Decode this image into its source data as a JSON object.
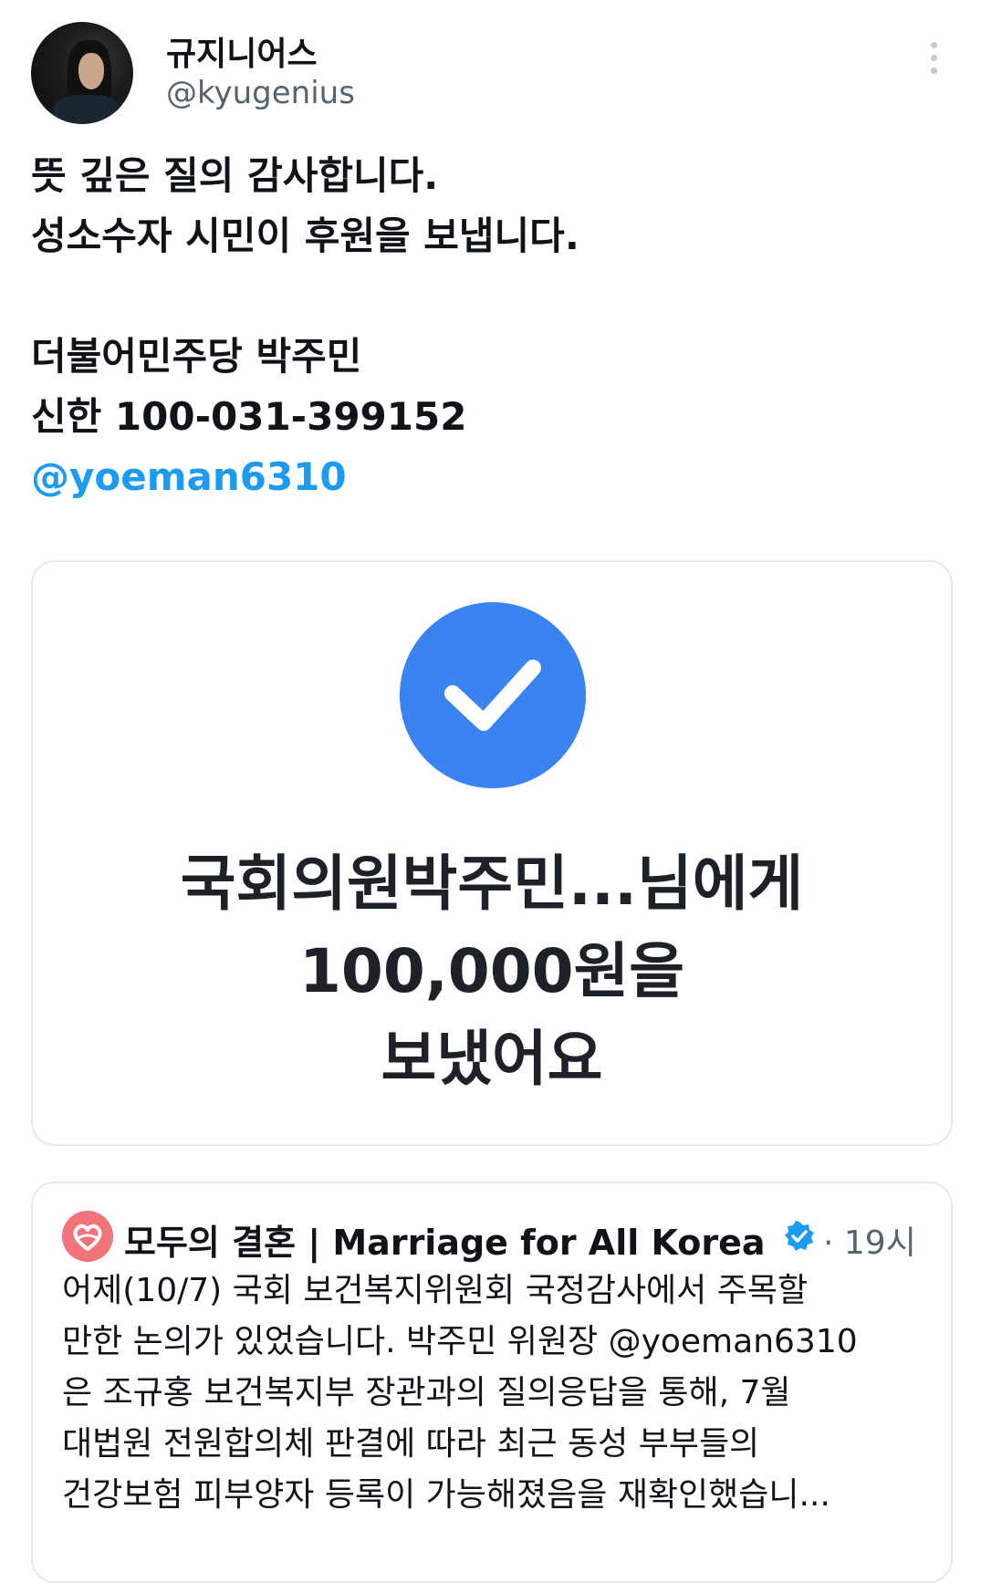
{
  "author": {
    "name": "규지니어스",
    "handle": "@kyugenius"
  },
  "tweet": {
    "lines": [
      "뜻 깊은 질의 감사합니다.",
      "성소수자 시민이 후원을 보냅니다.",
      "",
      "더불어민주당 박주민",
      "신한 100-031-399152"
    ],
    "mention": "@yoeman6310"
  },
  "card": {
    "lines": [
      "국회의원박주민...님에게",
      "100,000원을",
      "보냈어요"
    ],
    "check_color": "#3a83f0"
  },
  "quoted": {
    "account_name": "모두의 결혼 | Marriage for All Korea",
    "time": "· 19시",
    "lines": [
      "어제(10/7) 국회 보건복지위원회 국정감사에서 주목할",
      "만한 논의가 있었습니다. 박주민 위원장 @yoeman6310",
      "은 조규홍 보건복지부 장관과의 질의응답을 통해, 7월",
      "대법원 전원합의체 판결에 따라 최근 동성 부부들의",
      "건강보험 피부양자 등록이 가능해졌음을 재확인했습니..."
    ]
  },
  "colors": {
    "link": "#1d9bf0",
    "secondary_text": "#536471",
    "verified": "#1d9bf0",
    "logo_bg": "#f1747b"
  }
}
